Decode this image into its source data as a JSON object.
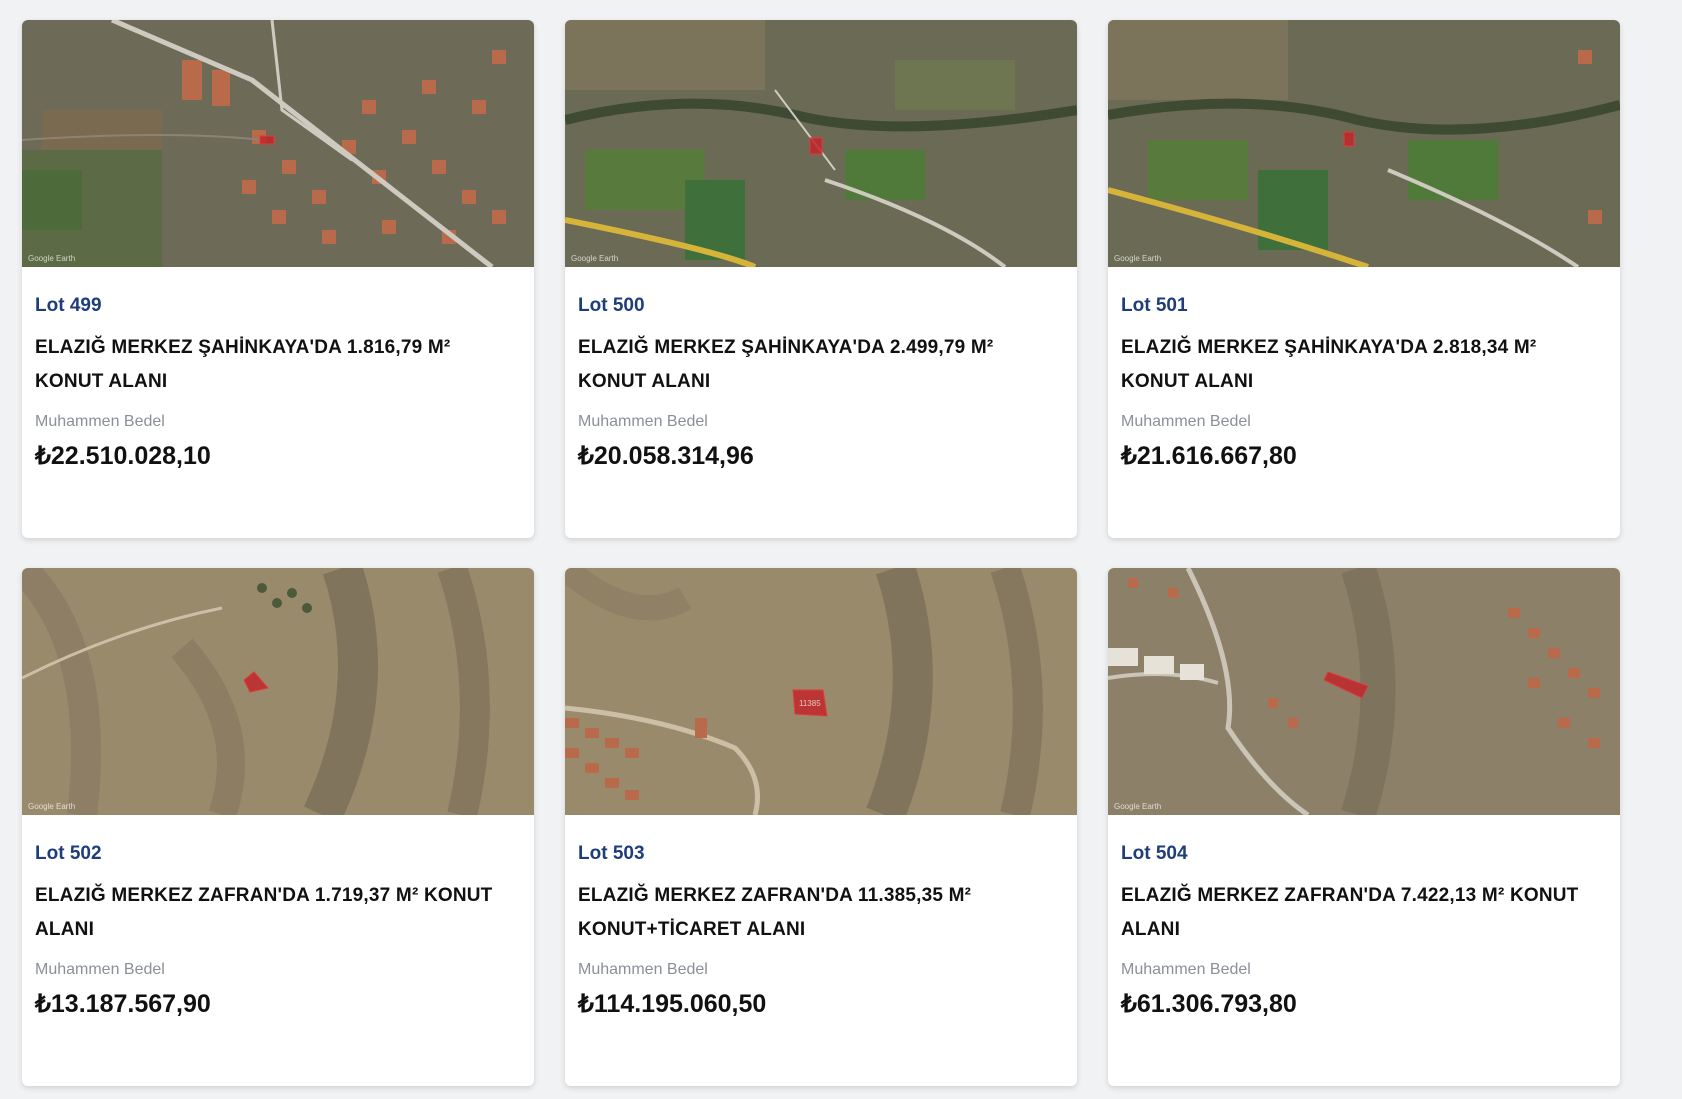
{
  "lots": [
    {
      "lot": "Lot 499",
      "title": "ELAZIĞ MERKEZ ŞAHİNKAYA'DA 1.816,79 M² KONUT ALANI",
      "price_label": "Muhammen Bedel",
      "price": "₺22.510.028,10",
      "map_credit": "Google Earth"
    },
    {
      "lot": "Lot 500",
      "title": "ELAZIĞ MERKEZ ŞAHİNKAYA'DA 2.499,79 M² KONUT ALANI",
      "price_label": "Muhammen Bedel",
      "price": "₺20.058.314,96",
      "map_credit": "Google Earth"
    },
    {
      "lot": "Lot 501",
      "title": "ELAZIĞ MERKEZ ŞAHİNKAYA'DA 2.818,34 M² KONUT ALANI",
      "price_label": "Muhammen Bedel",
      "price": "₺21.616.667,80",
      "map_credit": "Google Earth"
    },
    {
      "lot": "Lot 502",
      "title": "ELAZIĞ MERKEZ ZAFRAN'DA 1.719,37 M² KONUT ALANI",
      "price_label": "Muhammen Bedel",
      "price": "₺13.187.567,90",
      "map_credit": "Google Earth"
    },
    {
      "lot": "Lot 503",
      "title": "ELAZIĞ MERKEZ ZAFRAN'DA 11.385,35 M² KONUT+TİCARET ALANI",
      "price_label": "Muhammen Bedel",
      "price": "₺114.195.060,50",
      "map_credit": "Google Earth"
    },
    {
      "lot": "Lot 504",
      "title": "ELAZIĞ MERKEZ ZAFRAN'DA 7.422,13 M² KONUT ALANI",
      "price_label": "Muhammen Bedel",
      "price": "₺61.306.793,80",
      "map_credit": "Google Earth"
    }
  ],
  "colors": {
    "lot_label": "#1f3d7a",
    "title": "#111111",
    "price_label": "#8a8f98",
    "plot_highlight": "#c0262a",
    "page_background": "#f1f2f4"
  }
}
